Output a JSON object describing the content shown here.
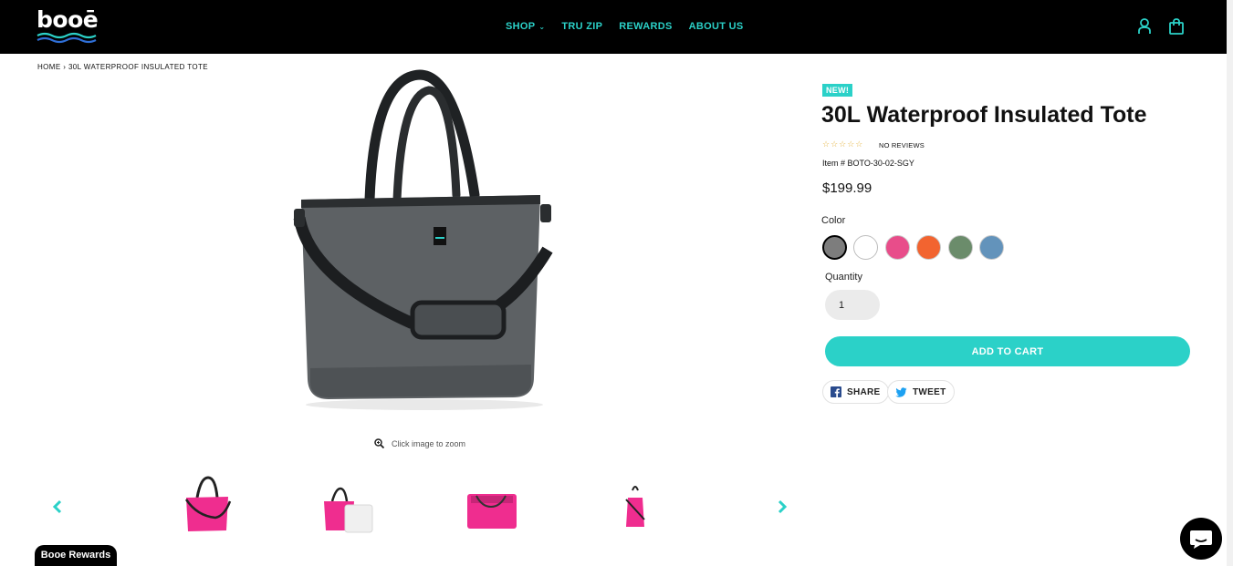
{
  "header": {
    "logo_text": "booē",
    "nav": [
      {
        "label": "SHOP",
        "has_caret": true
      },
      {
        "label": "TRU ZIP"
      },
      {
        "label": "REWARDS"
      },
      {
        "label": "ABOUT US"
      }
    ],
    "icons": [
      "account-icon",
      "cart-icon"
    ]
  },
  "breadcrumb": {
    "home": "HOME",
    "separator": "›",
    "current": "30L WATERPROOF INSULATED TOTE"
  },
  "gallery": {
    "zoom_hint": "Click image to zoom",
    "main_image_color": "#5d6164",
    "thumbnails": [
      {
        "name": "thumb-pink-tote-front"
      },
      {
        "name": "thumb-pink-tote-with-liner"
      },
      {
        "name": "thumb-pink-tote-top"
      },
      {
        "name": "thumb-pink-tote-side"
      }
    ]
  },
  "product": {
    "badge": "NEW!",
    "title": "30L Waterproof Insulated Tote",
    "stars": "☆☆☆☆☆",
    "reviews": "NO REVIEWS",
    "sku": "Item # BOTO-30-02-SGY",
    "price": "$199.99",
    "color_label": "Color",
    "colors": [
      "#7d7d7d",
      "#ffffff",
      "#e84d8a",
      "#f26430",
      "#6b8c6b",
      "#6393bb"
    ],
    "selected_color_index": 0,
    "quantity_label": "Quantity",
    "quantity": "1",
    "add_to_cart": "ADD TO CART",
    "share_label": "SHARE",
    "tweet_label": "TWEET"
  },
  "floating": {
    "rewards": "Booe Rewards"
  },
  "colors": {
    "accent": "#2bd1c8",
    "header_bg": "#000000"
  }
}
